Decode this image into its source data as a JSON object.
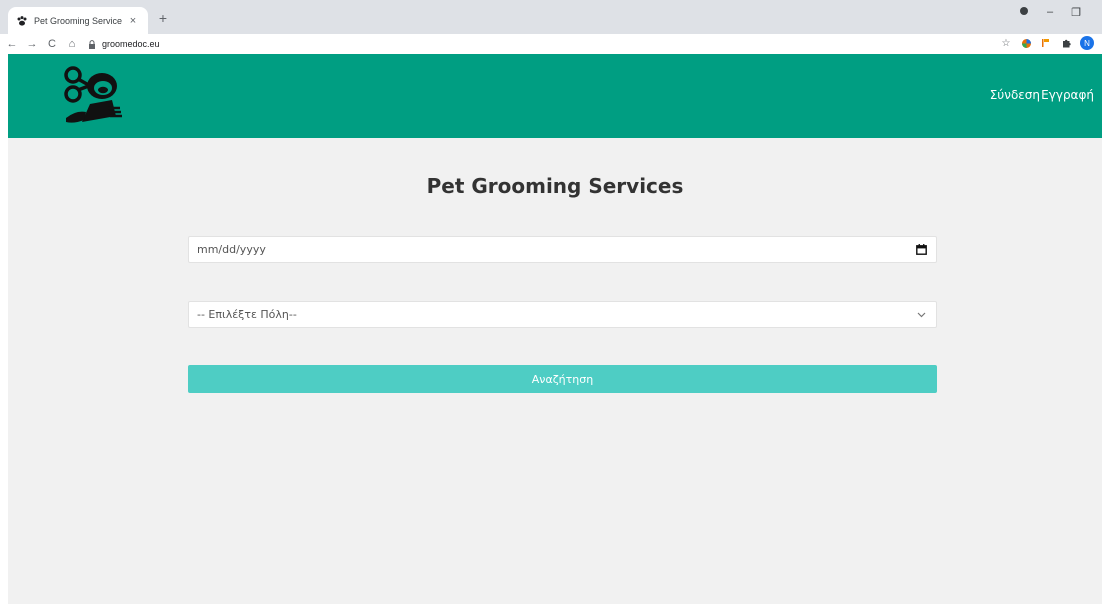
{
  "browser": {
    "tab_title": "Pet Grooming Service",
    "tab_close": "×",
    "new_tab": "+",
    "url": "groomedoc.eu",
    "nav": {
      "back": "←",
      "forward": "→",
      "reload": "C",
      "home": "⌂"
    },
    "profile_initial": "N",
    "window": {
      "minimize": "–",
      "maximize": "❐"
    }
  },
  "header": {
    "login_label": "Σύνδεση",
    "register_label": "Εγγραφή",
    "bg_color": "#009e82"
  },
  "main": {
    "title": "Pet Grooming Services",
    "date_placeholder": "mm/dd/yyyy",
    "city_select_value": "-- Επιλέξτε Πόλη--",
    "search_label": "Αναζήτηση",
    "search_color": "#4ecdc4"
  },
  "icons": [
    "paw-icon",
    "lock-icon",
    "calendar-icon",
    "chevron-down-icon",
    "star-icon",
    "puzzle-icon",
    "logo-icon"
  ]
}
